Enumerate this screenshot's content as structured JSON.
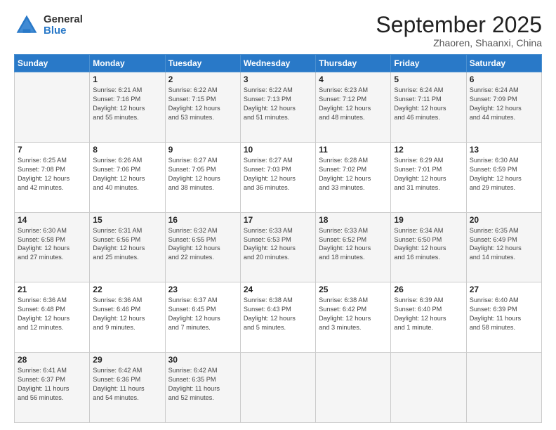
{
  "logo": {
    "general": "General",
    "blue": "Blue"
  },
  "header": {
    "month": "September 2025",
    "location": "Zhaoren, Shaanxi, China"
  },
  "weekdays": [
    "Sunday",
    "Monday",
    "Tuesday",
    "Wednesday",
    "Thursday",
    "Friday",
    "Saturday"
  ],
  "weeks": [
    [
      {
        "day": "",
        "info": ""
      },
      {
        "day": "1",
        "info": "Sunrise: 6:21 AM\nSunset: 7:16 PM\nDaylight: 12 hours\nand 55 minutes."
      },
      {
        "day": "2",
        "info": "Sunrise: 6:22 AM\nSunset: 7:15 PM\nDaylight: 12 hours\nand 53 minutes."
      },
      {
        "day": "3",
        "info": "Sunrise: 6:22 AM\nSunset: 7:13 PM\nDaylight: 12 hours\nand 51 minutes."
      },
      {
        "day": "4",
        "info": "Sunrise: 6:23 AM\nSunset: 7:12 PM\nDaylight: 12 hours\nand 48 minutes."
      },
      {
        "day": "5",
        "info": "Sunrise: 6:24 AM\nSunset: 7:11 PM\nDaylight: 12 hours\nand 46 minutes."
      },
      {
        "day": "6",
        "info": "Sunrise: 6:24 AM\nSunset: 7:09 PM\nDaylight: 12 hours\nand 44 minutes."
      }
    ],
    [
      {
        "day": "7",
        "info": "Sunrise: 6:25 AM\nSunset: 7:08 PM\nDaylight: 12 hours\nand 42 minutes."
      },
      {
        "day": "8",
        "info": "Sunrise: 6:26 AM\nSunset: 7:06 PM\nDaylight: 12 hours\nand 40 minutes."
      },
      {
        "day": "9",
        "info": "Sunrise: 6:27 AM\nSunset: 7:05 PM\nDaylight: 12 hours\nand 38 minutes."
      },
      {
        "day": "10",
        "info": "Sunrise: 6:27 AM\nSunset: 7:03 PM\nDaylight: 12 hours\nand 36 minutes."
      },
      {
        "day": "11",
        "info": "Sunrise: 6:28 AM\nSunset: 7:02 PM\nDaylight: 12 hours\nand 33 minutes."
      },
      {
        "day": "12",
        "info": "Sunrise: 6:29 AM\nSunset: 7:01 PM\nDaylight: 12 hours\nand 31 minutes."
      },
      {
        "day": "13",
        "info": "Sunrise: 6:30 AM\nSunset: 6:59 PM\nDaylight: 12 hours\nand 29 minutes."
      }
    ],
    [
      {
        "day": "14",
        "info": "Sunrise: 6:30 AM\nSunset: 6:58 PM\nDaylight: 12 hours\nand 27 minutes."
      },
      {
        "day": "15",
        "info": "Sunrise: 6:31 AM\nSunset: 6:56 PM\nDaylight: 12 hours\nand 25 minutes."
      },
      {
        "day": "16",
        "info": "Sunrise: 6:32 AM\nSunset: 6:55 PM\nDaylight: 12 hours\nand 22 minutes."
      },
      {
        "day": "17",
        "info": "Sunrise: 6:33 AM\nSunset: 6:53 PM\nDaylight: 12 hours\nand 20 minutes."
      },
      {
        "day": "18",
        "info": "Sunrise: 6:33 AM\nSunset: 6:52 PM\nDaylight: 12 hours\nand 18 minutes."
      },
      {
        "day": "19",
        "info": "Sunrise: 6:34 AM\nSunset: 6:50 PM\nDaylight: 12 hours\nand 16 minutes."
      },
      {
        "day": "20",
        "info": "Sunrise: 6:35 AM\nSunset: 6:49 PM\nDaylight: 12 hours\nand 14 minutes."
      }
    ],
    [
      {
        "day": "21",
        "info": "Sunrise: 6:36 AM\nSunset: 6:48 PM\nDaylight: 12 hours\nand 12 minutes."
      },
      {
        "day": "22",
        "info": "Sunrise: 6:36 AM\nSunset: 6:46 PM\nDaylight: 12 hours\nand 9 minutes."
      },
      {
        "day": "23",
        "info": "Sunrise: 6:37 AM\nSunset: 6:45 PM\nDaylight: 12 hours\nand 7 minutes."
      },
      {
        "day": "24",
        "info": "Sunrise: 6:38 AM\nSunset: 6:43 PM\nDaylight: 12 hours\nand 5 minutes."
      },
      {
        "day": "25",
        "info": "Sunrise: 6:38 AM\nSunset: 6:42 PM\nDaylight: 12 hours\nand 3 minutes."
      },
      {
        "day": "26",
        "info": "Sunrise: 6:39 AM\nSunset: 6:40 PM\nDaylight: 12 hours\nand 1 minute."
      },
      {
        "day": "27",
        "info": "Sunrise: 6:40 AM\nSunset: 6:39 PM\nDaylight: 11 hours\nand 58 minutes."
      }
    ],
    [
      {
        "day": "28",
        "info": "Sunrise: 6:41 AM\nSunset: 6:37 PM\nDaylight: 11 hours\nand 56 minutes."
      },
      {
        "day": "29",
        "info": "Sunrise: 6:42 AM\nSunset: 6:36 PM\nDaylight: 11 hours\nand 54 minutes."
      },
      {
        "day": "30",
        "info": "Sunrise: 6:42 AM\nSunset: 6:35 PM\nDaylight: 11 hours\nand 52 minutes."
      },
      {
        "day": "",
        "info": ""
      },
      {
        "day": "",
        "info": ""
      },
      {
        "day": "",
        "info": ""
      },
      {
        "day": "",
        "info": ""
      }
    ]
  ]
}
